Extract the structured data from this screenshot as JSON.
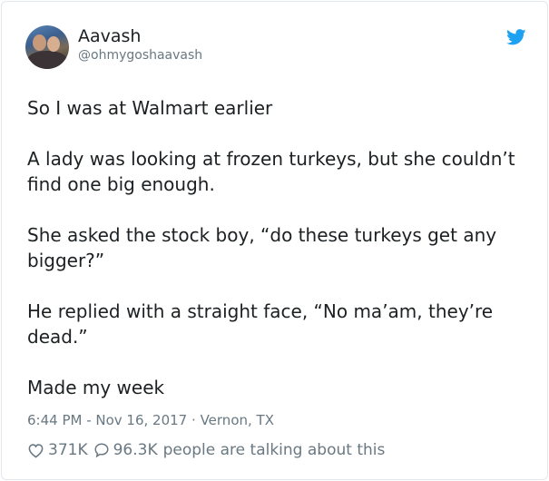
{
  "author": {
    "display_name": "Aavash",
    "handle": "@ohmygoshaavash"
  },
  "icons": {
    "platform": "twitter-bird-icon",
    "like": "heart-icon",
    "reply": "speech-bubble-icon"
  },
  "colors": {
    "brand": "#1da1f2",
    "text": "#1c2022",
    "muted": "#697882"
  },
  "tweet": {
    "paragraphs": [
      "So I was at Walmart earlier",
      "A lady was looking at frozen turkeys, but she couldn’t find one big enough.",
      "She asked the stock boy, “do these turkeys get any bigger?”",
      "He replied with a straight face, “No ma’am, they’re dead.”",
      "Made my week"
    ],
    "timestamp": "6:44 PM - Nov 16, 2017",
    "separator": "·",
    "location": "Vernon, TX"
  },
  "engagement": {
    "likes": "371K",
    "replies": "96.3K",
    "talking_text": "people are talking about this"
  }
}
